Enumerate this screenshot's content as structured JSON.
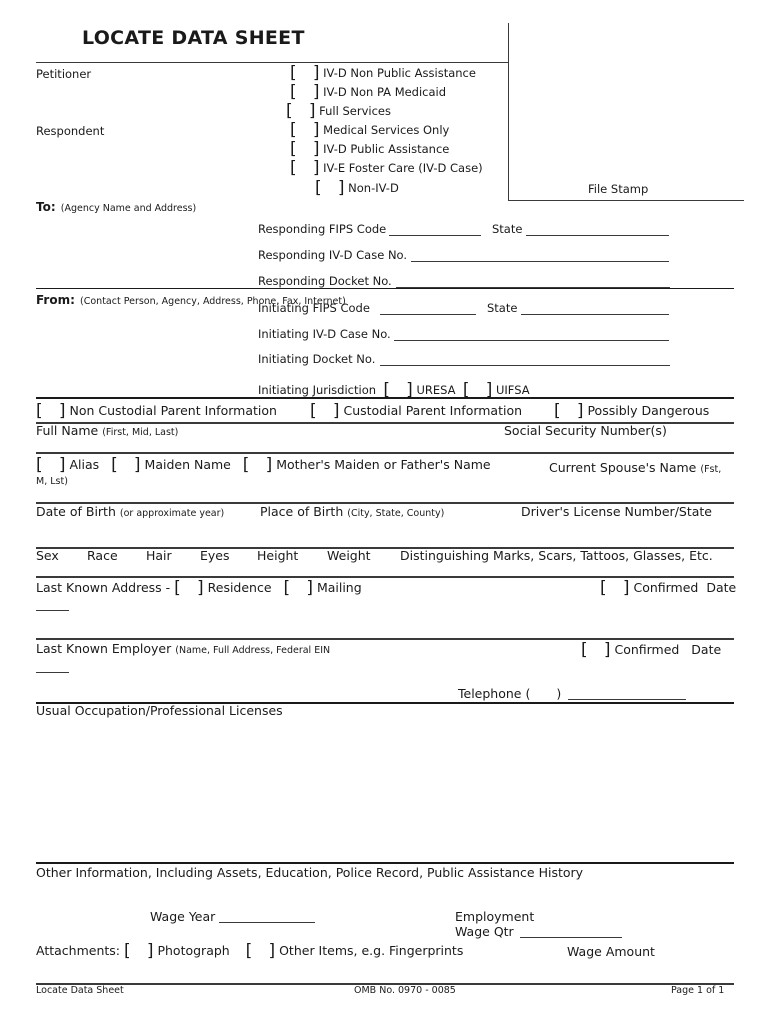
{
  "header": {
    "title": "LOCATE DATA SHEET",
    "petitioner": "Petitioner",
    "respondent": "Respondent",
    "file_stamp": "File Stamp"
  },
  "case_types": [
    {
      "label": "IV-D Non Public Assistance",
      "checked": false
    },
    {
      "label": "IV-D Non PA Medicaid",
      "checked": false
    },
    {
      "label": "Full Services",
      "checked": false
    },
    {
      "label": "Medical Services Only",
      "checked": false
    },
    {
      "label": "IV-D Public Assistance",
      "checked": false
    },
    {
      "label": "IV-E Foster Care (IV-D Case)",
      "checked": false
    },
    {
      "label": "Non-IV-D",
      "checked": false
    }
  ],
  "to": {
    "label": "To",
    "hint": "(Agency Name and Address)",
    "fips_label": "Responding FIPS Code",
    "state_label": "State",
    "case_no_label": "Responding IV-D Case No.",
    "docket_label": "Responding Docket No."
  },
  "from": {
    "label": "From",
    "hint": "(Contact Person, Agency, Address, Phone, Fax, Internet)",
    "fips_label": "Initiating FIPS Code",
    "state_label": "State",
    "case_no_label": "Initiating IV-D Case No.",
    "docket_label": "Initiating Docket No.",
    "jurisdiction_label": "Initiating Jurisdiction",
    "jurisdiction_options": [
      "URESA",
      "UIFSA"
    ]
  },
  "party_type": {
    "options": [
      "Non Custodial Parent Information",
      "Custodial Parent Information",
      "Possibly Dangerous"
    ]
  },
  "person": {
    "full_name_label": "Full Name",
    "full_name_hint": "(First, Mid, Last)",
    "ssn_label": "Social Security Number(s)",
    "name_options": [
      "Alias",
      "Maiden Name",
      "Mother's Maiden or Father's Name"
    ],
    "spouse_label": "Current Spouse's Name",
    "spouse_hint_a": "(Fst,",
    "spouse_hint_b": "M, Lst)",
    "dob_label": "Date of Birth",
    "dob_hint": "(or approximate year)",
    "pob_label": "Place of Birth",
    "pob_hint": "(City, State, County)",
    "dl_label": "Driver's License Number/State",
    "descriptors": [
      "Sex",
      "Race",
      "Hair",
      "Eyes",
      "Height",
      "Weight",
      "Distinguishing Marks, Scars, Tattoos, Glasses, Etc."
    ]
  },
  "address": {
    "label": "Last Known Address -",
    "options": [
      "Residence",
      "Mailing"
    ],
    "confirmed_label": "Confirmed",
    "date_label": "Date"
  },
  "employer": {
    "label": "Last Known Employer",
    "hint": "(Name, Full Address, Federal EIN",
    "confirmed_label": "Confirmed",
    "date_label": "Date",
    "telephone_label": "Telephone (",
    "telephone_close": ")"
  },
  "occupation": {
    "label": "Usual Occupation/Professional Licenses"
  },
  "other": {
    "label": "Other Information, Including Assets, Education, Police Record, Public Assistance History",
    "wage_year_label": "Wage Year",
    "employment_label": "Employment",
    "wage_qtr_label": "Wage Qtr",
    "wage_amount_label": "Wage Amount",
    "attachments_label": "Attachments:",
    "attachment_options": [
      "Photograph",
      "Other Items, e.g. Fingerprints"
    ]
  },
  "footer": {
    "left": "Locate Data Sheet",
    "center": "OMB No. 0970 - 0085",
    "right": "Page 1 of 1"
  }
}
